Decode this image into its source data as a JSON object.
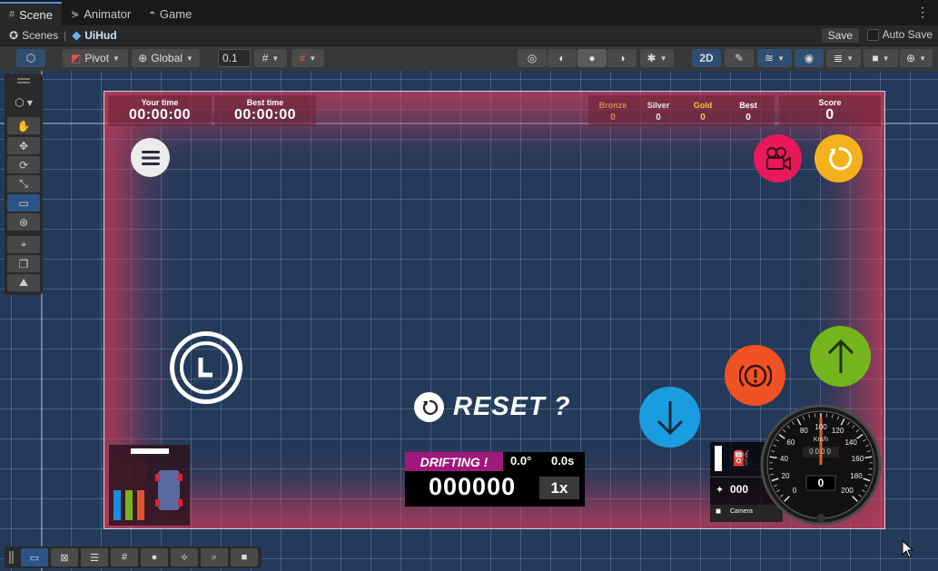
{
  "tabs": [
    {
      "label": "Scene",
      "icon": "grid-icon"
    },
    {
      "label": "Animator",
      "icon": "animator-icon"
    },
    {
      "label": "Game",
      "icon": "gamepad-icon"
    }
  ],
  "breadcrumb": {
    "root": "Scenes",
    "current": "UiHud"
  },
  "header": {
    "save_label": "Save",
    "autosave_label": "Auto Save"
  },
  "toolbar": {
    "pivot": "Pivot",
    "space": "Global",
    "snap_value": "0.1",
    "mode_2d": "2D"
  },
  "hud": {
    "your_time_label": "Your time",
    "your_time": "00:00:00",
    "best_time_label": "Best time",
    "best_time": "00:00:00",
    "medals": [
      {
        "label": "Bronze",
        "value": "0",
        "color": "#d58a46"
      },
      {
        "label": "Silver",
        "value": "0",
        "color": "#e6e6e6"
      },
      {
        "label": "Gold",
        "value": "0",
        "color": "#f2c531"
      },
      {
        "label": "Best",
        "value": "0",
        "color": "#ffffff"
      }
    ],
    "score_label": "Score",
    "score": "0",
    "reset_text": "RESET ?",
    "drifting_label": "DRIFTING !",
    "drift_angle": "0.0°",
    "drift_time": "0.0s",
    "drift_score": "000000",
    "multiplier": "1x",
    "speed_value": "0",
    "speed_unit": "Km/h",
    "odometer": "0000",
    "gauge_ticks": [
      "0",
      "20",
      "40",
      "60",
      "80",
      "100",
      "120",
      "140",
      "160",
      "180",
      "200"
    ],
    "nitro_value": "000",
    "camera_label": "Camera",
    "colors": {
      "restart": "#f3b21c",
      "camera": "#e8185b",
      "brake": "#f05223",
      "gas": "#74b41c",
      "down": "#1a9de0",
      "drift": "#a0187a"
    }
  }
}
